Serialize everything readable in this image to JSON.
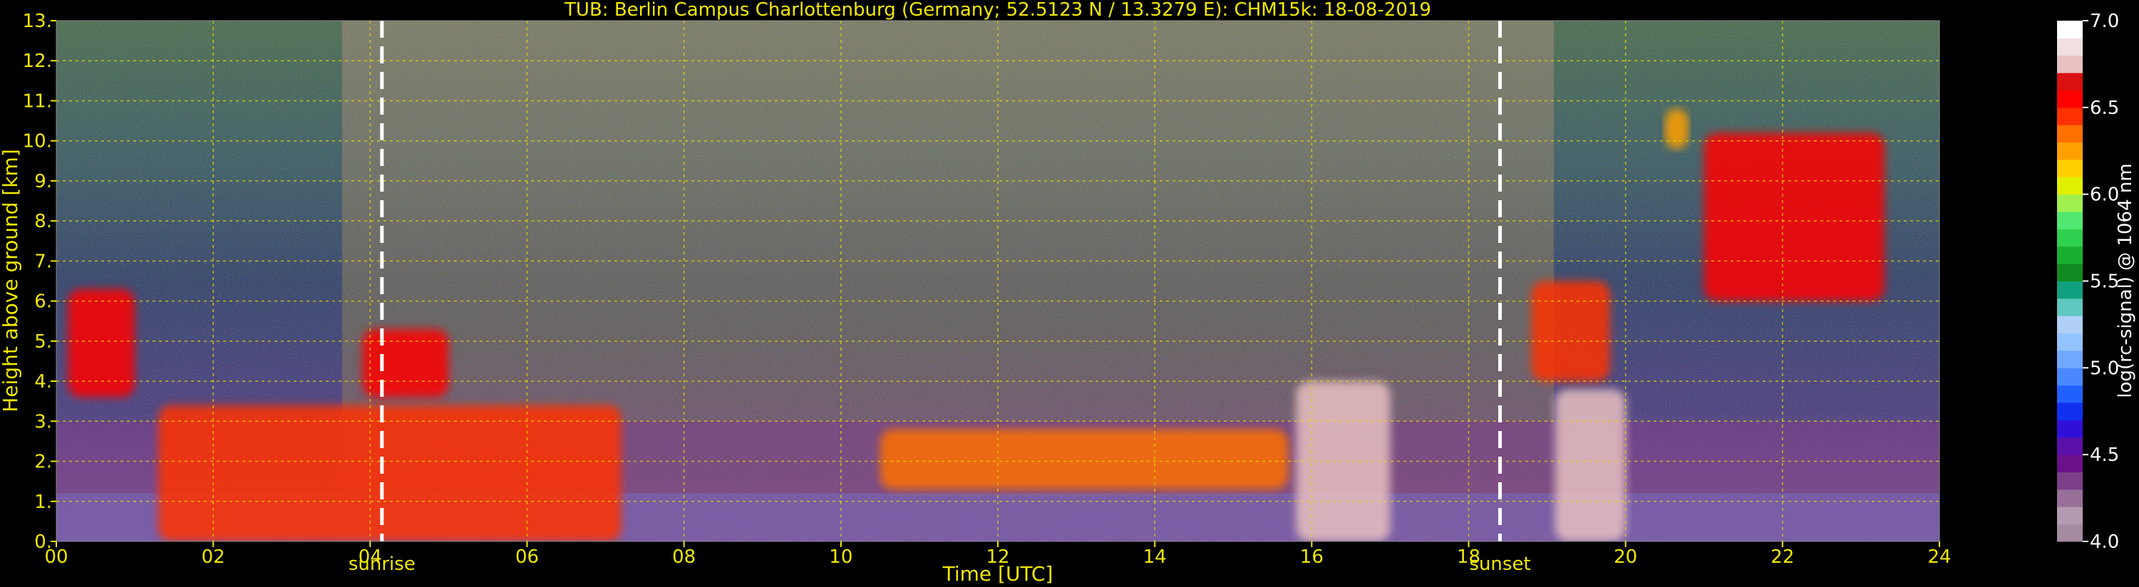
{
  "chart_data": {
    "type": "heatmap",
    "title": "TUB: Berlin Campus Charlottenburg (Germany; 52.5123 N / 13.3279 E):    CHM15k: 18-08-2019",
    "xlabel": "Time [UTC]",
    "ylabel": "Height above ground [km]",
    "xlim": [
      0,
      24
    ],
    "ylim": [
      0,
      13
    ],
    "x_ticks": [
      0,
      2,
      4,
      6,
      8,
      10,
      12,
      14,
      16,
      18,
      20,
      22,
      24
    ],
    "x_tick_labels": [
      "00",
      "02",
      "04",
      "06",
      "08",
      "10",
      "12",
      "14",
      "16",
      "18",
      "20",
      "22",
      "24"
    ],
    "y_ticks": [
      0,
      1,
      2,
      3,
      4,
      5,
      6,
      7,
      8,
      9,
      10,
      11,
      12,
      13
    ],
    "y_tick_labels": [
      "0.",
      "1.",
      "2.",
      "3.",
      "4.",
      "5.",
      "6.",
      "7.",
      "8.",
      "9.",
      "10.",
      "11.",
      "12.",
      "13."
    ],
    "grid": true,
    "events": [
      {
        "time": 4.15,
        "label": "sunrise"
      },
      {
        "time": 18.4,
        "label": "sunset"
      }
    ],
    "colorbar": {
      "label": "log(rc-signal) @ 1064 nm",
      "range": [
        4.0,
        7.0
      ],
      "ticks": [
        4.0,
        4.5,
        5.0,
        5.5,
        6.0,
        6.5,
        7.0
      ],
      "tick_labels": [
        "4.0",
        "4.5",
        "5.0",
        "5.5",
        "6.0",
        "6.5",
        "7.0"
      ],
      "colors": [
        "#a58aa0",
        "#b49ab0",
        "#986f98",
        "#7c3f8a",
        "#6a108a",
        "#5a10a8",
        "#3010d8",
        "#1030f0",
        "#2060ff",
        "#4a88ff",
        "#70a8ff",
        "#94c4ff",
        "#b0d0f8",
        "#60c8c0",
        "#10a080",
        "#108a20",
        "#18b030",
        "#30d050",
        "#50e870",
        "#a0f050",
        "#e0f000",
        "#ffd000",
        "#ffa000",
        "#ff7000",
        "#ff3000",
        "#ff0000",
        "#d81010",
        "#e8c0c0",
        "#f0e0e0",
        "#ffffff"
      ]
    },
    "features": [
      {
        "kind": "aerosol_layer",
        "t0": 0.0,
        "t1": 24.0,
        "h0": 0.0,
        "h1": 1.2,
        "value": 5.05
      },
      {
        "kind": "boundary_layer",
        "t0": 0.0,
        "t1": 24.0,
        "h0": 0.0,
        "h1": 3.0,
        "value": 4.35
      },
      {
        "kind": "cloud",
        "t0": 1.3,
        "t1": 7.2,
        "h0": 0.0,
        "h1": 3.4,
        "value": 6.4
      },
      {
        "kind": "cloud",
        "t0": 0.15,
        "t1": 1.0,
        "h0": 3.6,
        "h1": 6.3,
        "value": 6.6
      },
      {
        "kind": "cloud",
        "t0": 3.9,
        "t1": 5.0,
        "h0": 3.6,
        "h1": 5.3,
        "value": 6.5
      },
      {
        "kind": "cloud",
        "t0": 15.8,
        "t1": 17.0,
        "h0": 0.0,
        "h1": 4.0,
        "value": 6.8
      },
      {
        "kind": "cloud",
        "t0": 19.1,
        "t1": 20.0,
        "h0": 0.0,
        "h1": 3.8,
        "value": 6.7
      },
      {
        "kind": "cloud",
        "t0": 18.8,
        "t1": 19.8,
        "h0": 4.0,
        "h1": 6.5,
        "value": 6.4
      },
      {
        "kind": "cloud",
        "t0": 21.0,
        "t1": 23.3,
        "h0": 6.0,
        "h1": 10.2,
        "value": 6.5
      },
      {
        "kind": "cloud",
        "t0": 20.5,
        "t1": 20.8,
        "h0": 9.8,
        "h1": 10.8,
        "value": 6.2
      },
      {
        "kind": "cloud",
        "t0": 10.5,
        "t1": 15.7,
        "h0": 1.3,
        "h1": 2.8,
        "value": 6.3
      }
    ]
  }
}
